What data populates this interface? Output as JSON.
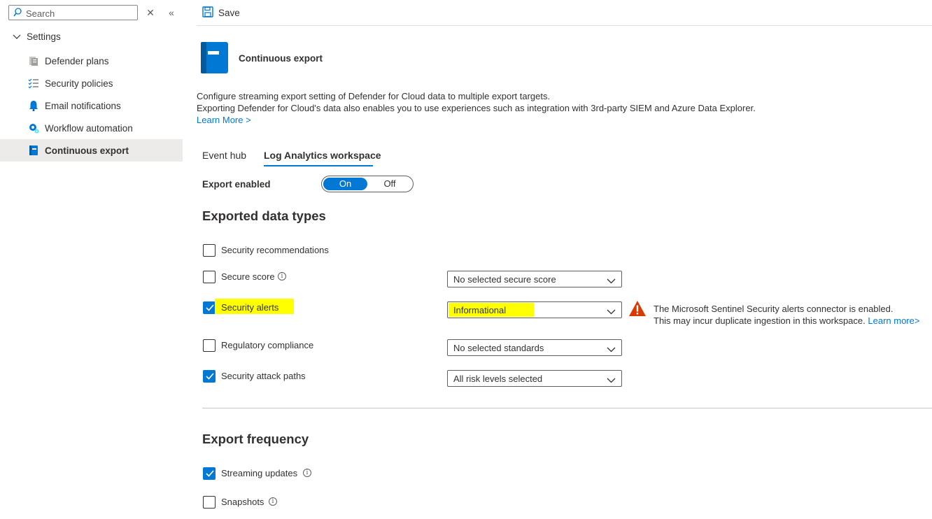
{
  "sidebar": {
    "search_placeholder": "Search",
    "tree_root": "Settings",
    "items": [
      {
        "label": "Defender plans",
        "icon": "defender-plans-icon"
      },
      {
        "label": "Security policies",
        "icon": "checklist-icon"
      },
      {
        "label": "Email notifications",
        "icon": "bell-icon"
      },
      {
        "label": "Workflow automation",
        "icon": "workflow-gear-icon"
      },
      {
        "label": "Continuous export",
        "icon": "export-book-icon",
        "active": true
      }
    ]
  },
  "toolbar": {
    "save_label": "Save"
  },
  "page": {
    "title": "Continuous export",
    "description_line1": "Configure streaming export setting of Defender for Cloud data to multiple export targets.",
    "description_line2": "Exporting Defender for Cloud's data also enables you to use experiences such as integration with 3rd-party SIEM and Azure Data Explorer.",
    "learn_more": "Learn More >"
  },
  "tabs": [
    {
      "label": "Event hub",
      "active": false
    },
    {
      "label": "Log Analytics workspace",
      "active": true
    }
  ],
  "export_enabled": {
    "label": "Export enabled",
    "on_label": "On",
    "off_label": "Off",
    "value": "On"
  },
  "exported_data_types": {
    "heading": "Exported data types",
    "rows": [
      {
        "label": "Security recommendations",
        "checked": false
      },
      {
        "label": "Secure score",
        "checked": false,
        "dropdown": "No selected secure score"
      },
      {
        "label": "Security alerts",
        "checked": true,
        "dropdown": "Informational"
      },
      {
        "label": "Regulatory compliance",
        "checked": false,
        "dropdown": "No selected standards"
      },
      {
        "label": "Security attack paths",
        "checked": true,
        "dropdown": "All risk levels selected"
      }
    ],
    "warning": {
      "line1": "The Microsoft Sentinel Security alerts connector is enabled.",
      "line2": "This may incur duplicate ingestion in this workspace.",
      "link": "Learn more>"
    }
  },
  "export_frequency": {
    "heading": "Export frequency",
    "rows": [
      {
        "label": "Streaming updates",
        "checked": true
      },
      {
        "label": "Snapshots",
        "checked": false
      }
    ]
  },
  "colors": {
    "accent": "#0078d4",
    "highlight": "#ffff00",
    "warning": "#d83b01"
  }
}
